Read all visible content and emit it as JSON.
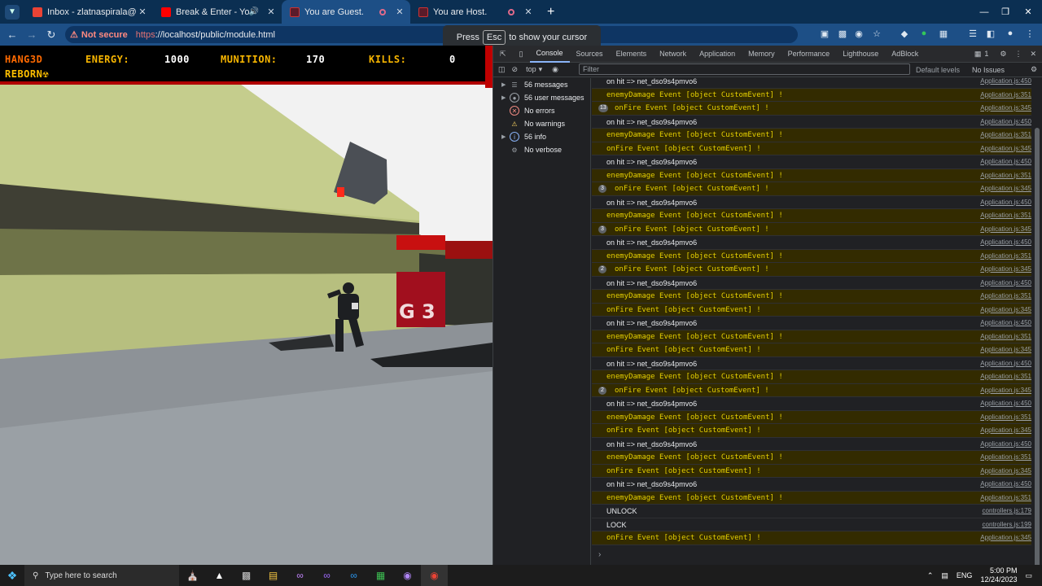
{
  "browser": {
    "tabs": [
      {
        "title": "Inbox - zlatnaspirala@gmail.co",
        "active": false
      },
      {
        "title": "Break & Enter - YouTube",
        "active": false
      },
      {
        "title": "You are Guest.",
        "active": true
      },
      {
        "title": "You are Host.",
        "active": false
      }
    ],
    "security_label": "Not secure",
    "url_scheme": "https",
    "url_rest": "://localhost/public/module.html",
    "toast": {
      "before": "Press",
      "key": "Esc",
      "after": "to show your cursor"
    }
  },
  "game": {
    "logo_line1": "HANG3D",
    "logo_line2": "REBORN☢",
    "energy_label": "ENERGY:",
    "energy_value": "1000",
    "munition_label": "MUNITION:",
    "munition_value": "170",
    "kills_label": "KILLS:",
    "kills_value": "0"
  },
  "devtools": {
    "tabs": [
      "Console",
      "Sources",
      "Elements",
      "Network",
      "Application",
      "Memory",
      "Performance",
      "Lighthouse",
      "AdBlock"
    ],
    "active_tab": "Console",
    "issues_count": "1",
    "context": "top",
    "filter_placeholder": "Filter",
    "levels": "Default levels",
    "issues_label": "No Issues",
    "sidebar": [
      {
        "label": "56 messages"
      },
      {
        "label": "56 user messages"
      },
      {
        "label": "No errors"
      },
      {
        "label": "No warnings"
      },
      {
        "label": "56 info"
      },
      {
        "label": "No verbose"
      }
    ],
    "console_rows": [
      {
        "type": "plain",
        "text": "on hit => net_dso9s4pmvo6",
        "src": "Application.js:450"
      },
      {
        "type": "warn",
        "text": "enemyDamage Event [object CustomEvent] !",
        "src": "Application.js:351"
      },
      {
        "type": "warn",
        "text": "onFire Event [object CustomEvent] !",
        "src": "Application.js:345",
        "badge": "13"
      },
      {
        "type": "plain",
        "text": "on hit => net_dso9s4pmvo6",
        "src": "Application.js:450"
      },
      {
        "type": "warn",
        "text": "enemyDamage Event [object CustomEvent] !",
        "src": "Application.js:351"
      },
      {
        "type": "warn",
        "text": "onFire Event [object CustomEvent] !",
        "src": "Application.js:345"
      },
      {
        "type": "plain",
        "text": "on hit => net_dso9s4pmvo6",
        "src": "Application.js:450"
      },
      {
        "type": "warn",
        "text": "enemyDamage Event [object CustomEvent] !",
        "src": "Application.js:351"
      },
      {
        "type": "warn",
        "text": "onFire Event [object CustomEvent] !",
        "src": "Application.js:345",
        "badge": "3"
      },
      {
        "type": "plain",
        "text": "on hit => net_dso9s4pmvo6",
        "src": "Application.js:450"
      },
      {
        "type": "warn",
        "text": "enemyDamage Event [object CustomEvent] !",
        "src": "Application.js:351"
      },
      {
        "type": "warn",
        "text": "onFire Event [object CustomEvent] !",
        "src": "Application.js:345",
        "badge": "3"
      },
      {
        "type": "plain",
        "text": "on hit => net_dso9s4pmvo6",
        "src": "Application.js:450"
      },
      {
        "type": "warn",
        "text": "enemyDamage Event [object CustomEvent] !",
        "src": "Application.js:351"
      },
      {
        "type": "warn",
        "text": "onFire Event [object CustomEvent] !",
        "src": "Application.js:345",
        "badge": "2"
      },
      {
        "type": "plain",
        "text": "on hit => net_dso9s4pmvo6",
        "src": "Application.js:450"
      },
      {
        "type": "warn",
        "text": "enemyDamage Event [object CustomEvent] !",
        "src": "Application.js:351"
      },
      {
        "type": "warn",
        "text": "onFire Event [object CustomEvent] !",
        "src": "Application.js:345"
      },
      {
        "type": "plain",
        "text": "on hit => net_dso9s4pmvo6",
        "src": "Application.js:450"
      },
      {
        "type": "warn",
        "text": "enemyDamage Event [object CustomEvent] !",
        "src": "Application.js:351"
      },
      {
        "type": "warn",
        "text": "onFire Event [object CustomEvent] !",
        "src": "Application.js:345"
      },
      {
        "type": "plain",
        "text": "on hit => net_dso9s4pmvo6",
        "src": "Application.js:450"
      },
      {
        "type": "warn",
        "text": "enemyDamage Event [object CustomEvent] !",
        "src": "Application.js:351"
      },
      {
        "type": "warn",
        "text": "onFire Event [object CustomEvent] !",
        "src": "Application.js:345",
        "badge": "2"
      },
      {
        "type": "plain",
        "text": "on hit => net_dso9s4pmvo6",
        "src": "Application.js:450"
      },
      {
        "type": "warn",
        "text": "enemyDamage Event [object CustomEvent] !",
        "src": "Application.js:351"
      },
      {
        "type": "warn",
        "text": "onFire Event [object CustomEvent] !",
        "src": "Application.js:345"
      },
      {
        "type": "plain",
        "text": "on hit => net_dso9s4pmvo6",
        "src": "Application.js:450"
      },
      {
        "type": "warn",
        "text": "enemyDamage Event [object CustomEvent] !",
        "src": "Application.js:351"
      },
      {
        "type": "warn",
        "text": "onFire Event [object CustomEvent] !",
        "src": "Application.js:345"
      },
      {
        "type": "plain",
        "text": "on hit => net_dso9s4pmvo6",
        "src": "Application.js:450"
      },
      {
        "type": "warn",
        "text": "enemyDamage Event [object CustomEvent] !",
        "src": "Application.js:351"
      },
      {
        "type": "plain",
        "text": "UNLOCK",
        "src": "controllers.js:179"
      },
      {
        "type": "plain",
        "text": "LOCK",
        "src": "controllers.js:199"
      },
      {
        "type": "warn",
        "text": "onFire Event [object CustomEvent] !",
        "src": "Application.js:345"
      }
    ],
    "prompt": "›"
  },
  "taskbar": {
    "search_placeholder": "Type here to search",
    "lang": "ENG",
    "time": "5:00 PM",
    "date": "12/24/2023"
  }
}
